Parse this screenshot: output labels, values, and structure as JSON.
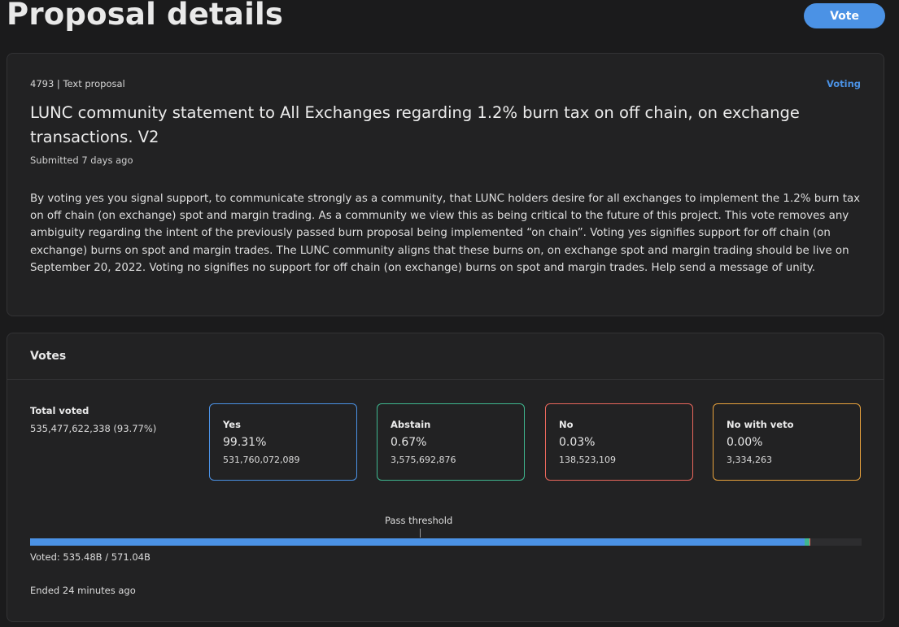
{
  "header": {
    "title": "Proposal details",
    "vote_button": "Vote"
  },
  "proposal": {
    "meta": "4793 | Text proposal",
    "status": "Voting",
    "title": "LUNC community statement to All Exchanges regarding 1.2% burn tax on off chain, on exchange transactions. V2",
    "submitted": "Submitted 7 days ago",
    "description": "By voting yes you signal support, to communicate strongly as a community, that LUNC holders desire for all exchanges to implement the 1.2% burn tax on off chain (on exchange) spot and margin trading. As a community we view this as being critical to the future of this project. This vote removes any ambiguity regarding the intent of the previously passed burn proposal being implemented “on chain”. Voting yes signifies support for off chain (on exchange) burns on spot and margin trades. The LUNC community aligns that these burns on, on exchange spot and margin trading should be live on September 20, 2022. Voting no signifies no support for off chain (on exchange) burns on spot and margin trades.  Help send a message of unity."
  },
  "votes": {
    "title": "Votes",
    "total_label": "Total voted",
    "total_value": "535,477,622,338 (93.77%)",
    "options": {
      "yes": {
        "label": "Yes",
        "pct": "99.31%",
        "amount": "531,760,072,089",
        "color": "#4b92e5"
      },
      "abstain": {
        "label": "Abstain",
        "pct": "0.67%",
        "amount": "3,575,692,876",
        "color": "#3fb78f"
      },
      "no": {
        "label": "No",
        "pct": "0.03%",
        "amount": "138,523,109",
        "color": "#e9675c"
      },
      "veto": {
        "label": "No with veto",
        "pct": "0.00%",
        "amount": "3,334,263",
        "color": "#e8a23c"
      }
    },
    "threshold_label": "Pass threshold",
    "voted_text": "Voted: 535.48B / 571.04B",
    "ended_text": "Ended 24 minutes ago",
    "progress": {
      "turnout_fraction": 0.9377,
      "yes": 531760072089,
      "abstain": 3575692876,
      "no": 138523109,
      "veto": 3334263
    }
  }
}
